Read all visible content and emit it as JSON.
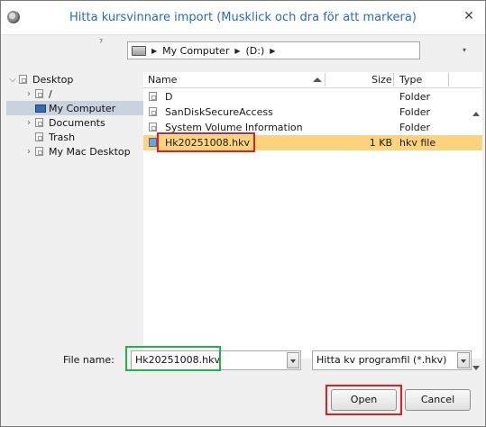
{
  "window": {
    "title": "Hitta kursvinnare import (Musklick och dra för att markera)",
    "close_glyph": "✕",
    "app_icon": "app-disc-icon"
  },
  "pathbar": {
    "top_glyph": "⁷",
    "crumbs": [
      "My Computer",
      "(D:)"
    ],
    "separator_glyph": "▶",
    "dropdown_glyph": "▾"
  },
  "sidebar": {
    "items": [
      {
        "label": "Desktop",
        "expand": "⌵"
      },
      {
        "label": "/",
        "expand": "›"
      },
      {
        "label": "My Computer",
        "expand": ""
      },
      {
        "label": "Documents",
        "expand": "›"
      },
      {
        "label": "Trash",
        "expand": ""
      },
      {
        "label": "My Mac Desktop",
        "expand": "›"
      }
    ],
    "selected_index": 2
  },
  "list": {
    "columns": {
      "name": "Name",
      "size": "Size",
      "type": "Type"
    },
    "rows": [
      {
        "name": "D",
        "size": "",
        "type": "Folder"
      },
      {
        "name": "SanDiskSecureAccess",
        "size": "",
        "type": "Folder"
      },
      {
        "name": "System Volume Information",
        "size": "",
        "type": "Folder"
      },
      {
        "name": "Hk20251008.hkv",
        "size": "1 KB",
        "type": "hkv file"
      }
    ],
    "selected_index": 3
  },
  "footer": {
    "filename_label": "File name:",
    "filename_value": "Hk20251008.hkv",
    "filter_value": "Hitta kv programfil (*.hkv)",
    "open_label": "Open",
    "cancel_label": "Cancel"
  },
  "colors": {
    "title_text": "#2b6cb0",
    "selection_row": "#fdd37d",
    "highlight_red": "#e02020",
    "highlight_green": "#22b14c"
  }
}
